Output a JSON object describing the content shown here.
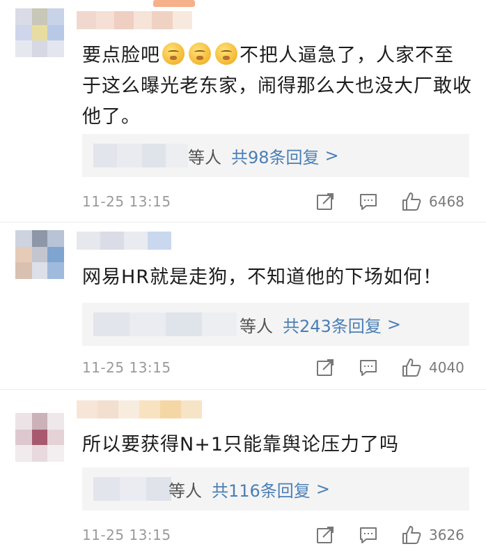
{
  "comments": [
    {
      "text_parts": [
        "要点脸吧",
        "不把人逼急了，人家不至于这么曝光老东家，闹得那么大也没大厂敢收他了。"
      ],
      "emoji_name": "shushing-face",
      "reply": {
        "suffix": "等人",
        "count": "共98条回复",
        "chevron": ">"
      },
      "timestamp": "11-25 13:15",
      "likes": "6468"
    },
    {
      "text": "网易HR就是走狗，不知道他的下场如何！",
      "reply": {
        "suffix": "等人",
        "count": "共243条回复",
        "chevron": ">"
      },
      "timestamp": "11-25 13:15",
      "likes": "4040"
    },
    {
      "text": "所以要获得N+1只能靠舆论压力了吗",
      "reply": {
        "suffix": "等人",
        "count": "共116条回复",
        "chevron": ">"
      },
      "timestamp": "11-25 13:15",
      "likes": "3626"
    }
  ],
  "icons": {
    "share": "share-icon",
    "comment": "comment-icon",
    "like": "like-icon"
  },
  "colors": {
    "link": "#4a7fb5",
    "muted": "#9a9a9a",
    "reply_bg": "#f4f4f4"
  }
}
